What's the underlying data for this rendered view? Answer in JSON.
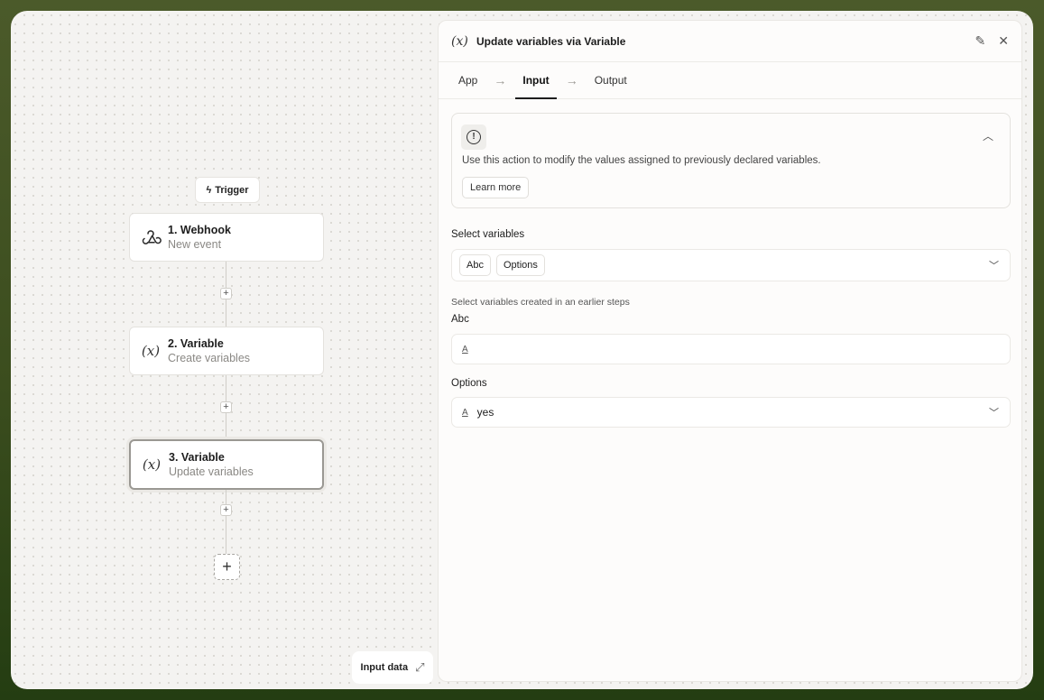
{
  "canvas": {
    "trigger_label": "Trigger",
    "nodes": [
      {
        "title": "1. Webhook",
        "subtitle": "New event",
        "icon": "webhook-icon"
      },
      {
        "title": "2. Variable",
        "subtitle": "Create variables",
        "icon": "variable-icon"
      },
      {
        "title": "3. Variable",
        "subtitle": "Update variables",
        "icon": "variable-icon"
      }
    ],
    "input_data_label": "Input data"
  },
  "panel": {
    "title": "Update variables via Variable",
    "tabs": [
      "App",
      "Input",
      "Output"
    ],
    "active_tab": "Input",
    "info": {
      "text": "Use this action to modify the values assigned to previously declared variables.",
      "learn_more": "Learn more"
    },
    "select_variables": {
      "label": "Select variables",
      "chips": [
        "Abc",
        "Options"
      ],
      "helper": "Select variables created in an earlier steps"
    },
    "abc": {
      "label": "Abc",
      "value": ""
    },
    "options": {
      "label": "Options",
      "value": "yes"
    }
  },
  "colors": {
    "background": "#3b4d1e",
    "canvas": "#f4f3f1",
    "panel": "#fdfcfb"
  }
}
